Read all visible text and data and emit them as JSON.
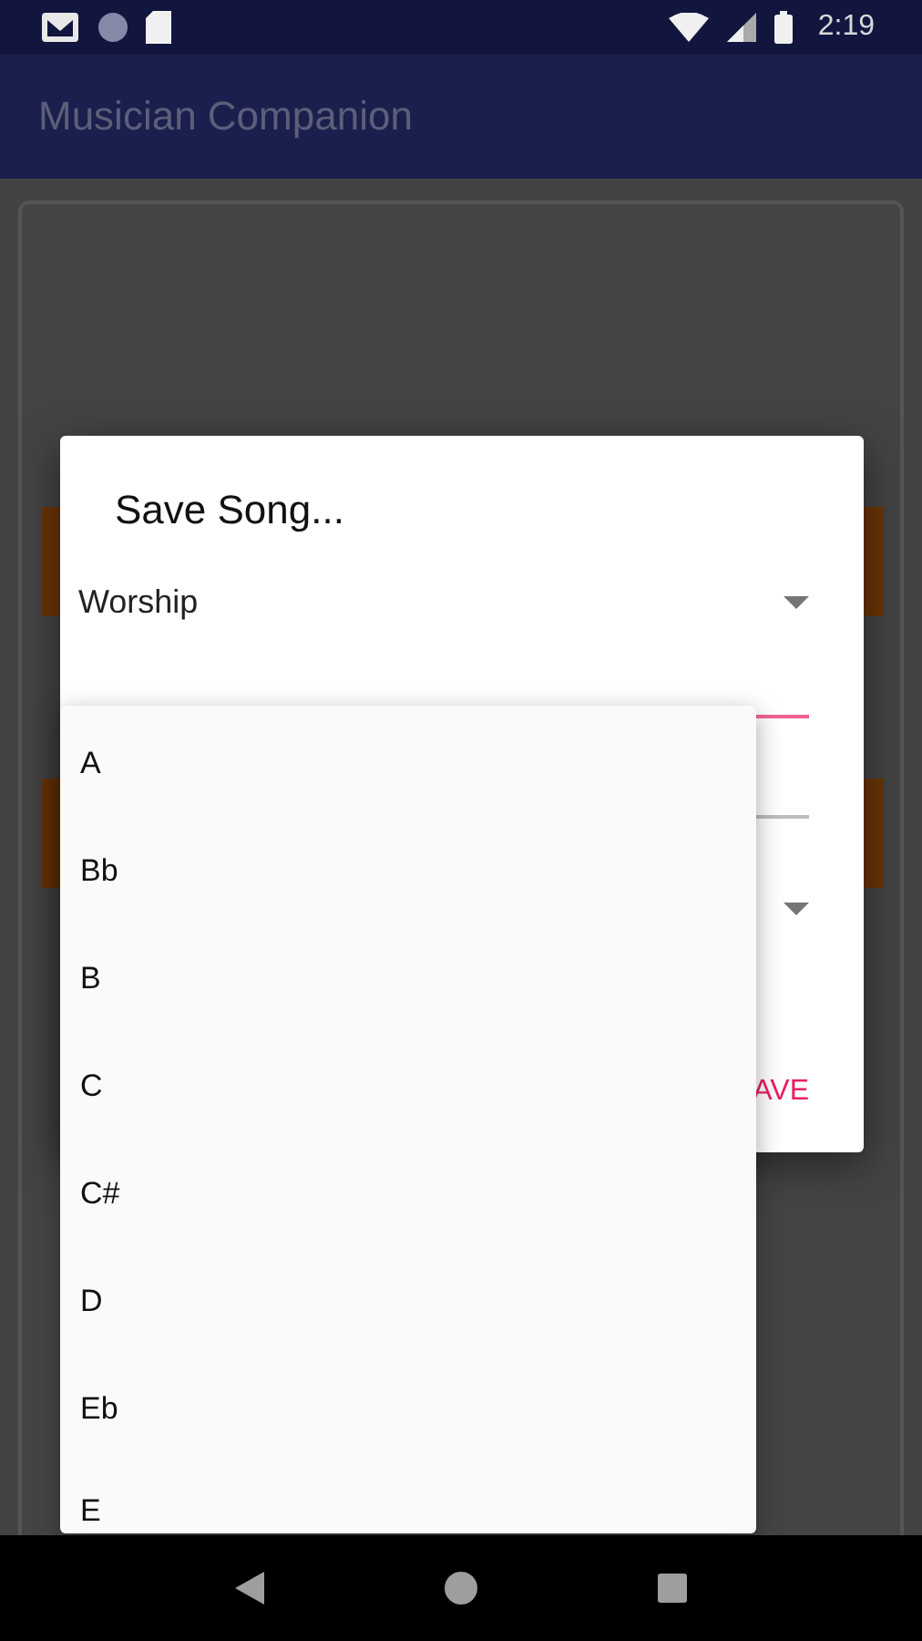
{
  "status_bar": {
    "time": "2:19"
  },
  "app_bar": {
    "title": "Musician Companion"
  },
  "dialog": {
    "title": "Save Song...",
    "category_dropdown": {
      "value": "Worship"
    },
    "fields": [
      {
        "focused": true
      },
      {
        "focused": false
      }
    ],
    "buttons": [
      "AVE"
    ]
  },
  "key_menu": {
    "items": [
      {
        "label": "A"
      },
      {
        "label": "Bb"
      },
      {
        "label": "B"
      },
      {
        "label": "C"
      },
      {
        "label": "C#"
      },
      {
        "label": "D"
      },
      {
        "label": "Eb"
      },
      {
        "label": "E"
      }
    ]
  }
}
